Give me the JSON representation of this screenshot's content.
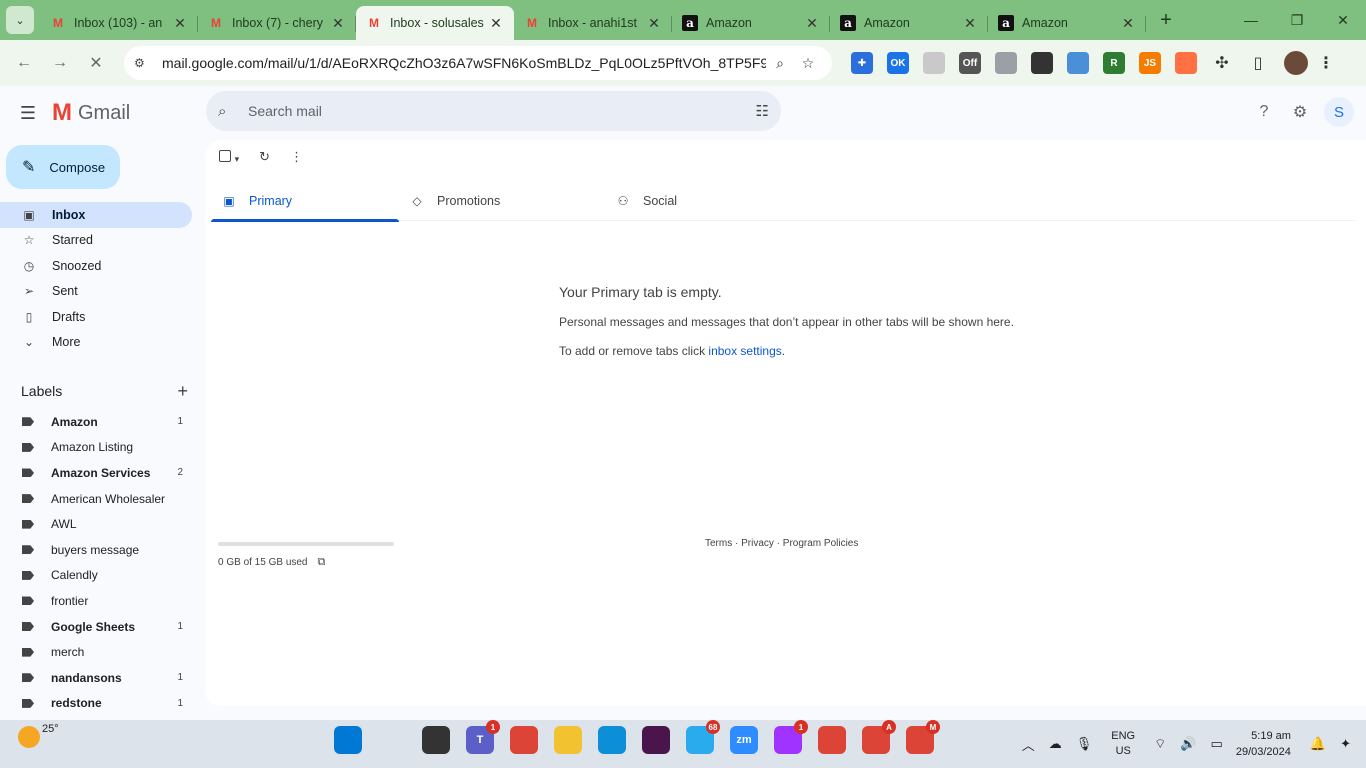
{
  "browser": {
    "tab_search_icon": "chevron-down",
    "tabs": [
      {
        "title": "Inbox (103) - an",
        "favicon": "gmail-icon",
        "active": false
      },
      {
        "title": "Inbox (7) - chery",
        "favicon": "gmail-icon",
        "active": false
      },
      {
        "title": "Inbox - solusales",
        "favicon": "gmail-icon",
        "active": true
      },
      {
        "title": "Inbox - anahi1st",
        "favicon": "gmail-icon",
        "active": false
      },
      {
        "title": "Amazon",
        "favicon": "amazon-icon",
        "active": false
      },
      {
        "title": "Amazon",
        "favicon": "amazon-icon",
        "active": false
      },
      {
        "title": "Amazon",
        "favicon": "amazon-icon",
        "active": false
      }
    ],
    "close_glyph": "✕",
    "new_tab_glyph": "+",
    "window_controls": [
      "—",
      "❐",
      "✕"
    ],
    "url": "mail.google.com/mail/u/1/d/AEoRXRQcZhO3z6A7wSFN6KoSmBLDz_PqL0OLz5PftVOh_8TP5F95/...",
    "theme_color": "#7fbf7f"
  },
  "gmail": {
    "app_name": "Gmail",
    "search_placeholder": "Search mail",
    "account_initial": "S",
    "compose_label": "Compose",
    "nav": [
      {
        "label": "Inbox",
        "icon": "inbox-icon",
        "glyph": "▣",
        "active": true
      },
      {
        "label": "Starred",
        "icon": "star-icon",
        "glyph": "☆",
        "active": false
      },
      {
        "label": "Snoozed",
        "icon": "clock-icon",
        "glyph": "◷",
        "active": false
      },
      {
        "label": "Sent",
        "icon": "send-icon",
        "glyph": "➢",
        "active": false
      },
      {
        "label": "Drafts",
        "icon": "draft-icon",
        "glyph": "▯",
        "active": false
      },
      {
        "label": "More",
        "icon": "chevron-down-icon",
        "glyph": "⌄",
        "active": false
      }
    ],
    "labels_title": "Labels",
    "labels": [
      {
        "name": "Amazon",
        "count": "1",
        "bold": true
      },
      {
        "name": "Amazon Listing",
        "count": "",
        "bold": false
      },
      {
        "name": "Amazon Services",
        "count": "2",
        "bold": true
      },
      {
        "name": "American Wholesaler",
        "count": "",
        "bold": false
      },
      {
        "name": "AWL",
        "count": "",
        "bold": false
      },
      {
        "name": "buyers message",
        "count": "",
        "bold": false
      },
      {
        "name": "Calendly",
        "count": "",
        "bold": false
      },
      {
        "name": "frontier",
        "count": "",
        "bold": false
      },
      {
        "name": "Google Sheets",
        "count": "1",
        "bold": true
      },
      {
        "name": "merch",
        "count": "",
        "bold": false
      },
      {
        "name": "nandansons",
        "count": "1",
        "bold": true
      },
      {
        "name": "redstone",
        "count": "1",
        "bold": true
      }
    ],
    "inbox_tabs": [
      {
        "label": "Primary",
        "icon": "inbox-icon",
        "glyph": "▣",
        "active": true
      },
      {
        "label": "Promotions",
        "icon": "tag-icon",
        "glyph": "◇",
        "active": false
      },
      {
        "label": "Social",
        "icon": "people-icon",
        "glyph": "⚇",
        "active": false
      }
    ],
    "empty_state": {
      "headline": "Your Primary tab is empty.",
      "description": "Personal messages and messages that don’t appear in other tabs will be shown here.",
      "hint_prefix": "To add or remove tabs click ",
      "hint_link": "inbox settings",
      "hint_suffix": "."
    },
    "storage": {
      "text": "0 GB of 15 GB used",
      "fraction": 0.0
    },
    "footer": "Terms · Privacy · Program Policies"
  },
  "taskbar": {
    "temperature": "25°",
    "apps": [
      {
        "name": "windows-start-icon",
        "color": "#0078d4",
        "label": "",
        "badge": ""
      },
      {
        "name": "search-icon",
        "color": "#dde3ea",
        "label": "",
        "badge": ""
      },
      {
        "name": "terminal-icon",
        "color": "#333333",
        "label": "",
        "badge": ""
      },
      {
        "name": "teams-icon",
        "color": "#5b5fc7",
        "label": "T",
        "badge": "1"
      },
      {
        "name": "chrome-icon",
        "color": "#db4437",
        "label": "",
        "badge": ""
      },
      {
        "name": "file-explorer-icon",
        "color": "#f2c230",
        "label": "",
        "badge": ""
      },
      {
        "name": "edge-icon",
        "color": "#0c8fd6",
        "label": "",
        "badge": ""
      },
      {
        "name": "slack-icon",
        "color": "#4a154b",
        "label": "",
        "badge": ""
      },
      {
        "name": "telegram-icon",
        "color": "#2aabee",
        "label": "",
        "badge": "68"
      },
      {
        "name": "zoom-icon",
        "color": "#2d8cff",
        "label": "zm",
        "badge": ""
      },
      {
        "name": "messenger-icon",
        "color": "#a033ff",
        "label": "",
        "badge": "1"
      },
      {
        "name": "chrome-profile-icon",
        "color": "#db4437",
        "label": "",
        "badge": ""
      },
      {
        "name": "chrome-profile-a-icon",
        "color": "#db4437",
        "label": "",
        "badge": "A"
      },
      {
        "name": "chrome-profile-m-icon",
        "color": "#db4437",
        "label": "",
        "badge": "M"
      }
    ],
    "lang_top": "ENG",
    "lang_bottom": "US",
    "time": "5:19 am",
    "date": "29/03/2024"
  }
}
